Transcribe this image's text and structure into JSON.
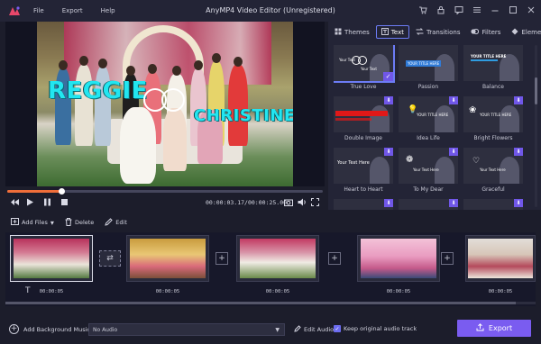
{
  "app": {
    "title": "AnyMP4 Video Editor (Unregistered)",
    "menu": [
      "File",
      "Export",
      "Help"
    ],
    "window_controls": [
      "cart-icon",
      "register-icon",
      "feedback-icon",
      "menu-icon",
      "minimize-icon",
      "maximize-icon",
      "close-icon"
    ]
  },
  "preview": {
    "overlay_text_1": "REGGIE",
    "overlay_text_2": "CHRISTINE",
    "current_time": "00:00:03.17",
    "total_time": "00:00:25.00",
    "progress_fraction": 0.17,
    "controls": [
      "prev-frame-icon",
      "play-icon",
      "pause-icon",
      "stop-icon"
    ]
  },
  "panel": {
    "tabs": [
      {
        "label": "Themes",
        "icon": "themes-icon"
      },
      {
        "label": "Text",
        "icon": "text-icon",
        "active": true
      },
      {
        "label": "Transitions",
        "icon": "transitions-icon"
      },
      {
        "label": "Filters",
        "icon": "filters-icon"
      },
      {
        "label": "Elements",
        "icon": "elements-icon"
      }
    ],
    "tiles": [
      {
        "label": "True Love",
        "selected": true
      },
      {
        "label": "Passion",
        "thumb_text": "YOUR TITLE HERE"
      },
      {
        "label": "Balance",
        "thumb_text": "YOUR TITLE HERE"
      },
      {
        "label": "Double Image",
        "download": true
      },
      {
        "label": "Idea Life",
        "download": true,
        "thumb_text": "YOUR TITLE HERE"
      },
      {
        "label": "Bright Flowers",
        "download": true,
        "thumb_text": "YOUR TITLE HERE"
      },
      {
        "label": "Heart to Heart",
        "download": true,
        "thumb_text": "Your Text Here"
      },
      {
        "label": "To My Dear",
        "download": true,
        "thumb_text": "Your Text Here"
      },
      {
        "label": "Graceful",
        "download": true,
        "thumb_text": "Your Text Here"
      },
      {
        "label": "",
        "download": true
      },
      {
        "label": "",
        "download": true
      },
      {
        "label": "",
        "download": true
      }
    ]
  },
  "toolbar": {
    "add_files": "Add Files",
    "delete": "Delete",
    "edit": "Edit"
  },
  "timeline": {
    "clips": [
      {
        "duration": "00:00:05",
        "selected": true
      },
      {
        "duration": "00:00:05"
      },
      {
        "duration": "00:00:05"
      },
      {
        "duration": "00:00:05"
      },
      {
        "duration": "00:00:05"
      }
    ]
  },
  "bottom": {
    "bg_music_label": "Add Background Music:",
    "audio_value": "No Audio",
    "edit_audio": "Edit Audio",
    "keep_audio": "Keep original audio track",
    "export_label": "Export"
  },
  "colors": {
    "accent": "#7a5cf0",
    "tab_border": "#6c7cf5",
    "progress": "#f06e3a",
    "overlay_text": "#22e6f0"
  }
}
